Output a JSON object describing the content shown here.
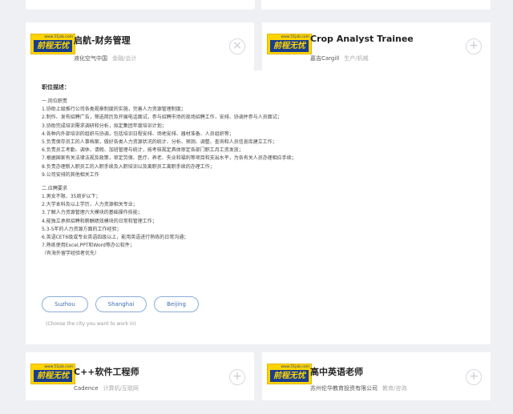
{
  "logo": {
    "url": "www.51job.com",
    "brand": "前程无忧"
  },
  "jobs": [
    {
      "title": "启航-财务管理",
      "company": "液化空气中国",
      "industry": "金融/会计",
      "action": "close"
    },
    {
      "title": "Crop Analyst Trainee",
      "company": "嘉吉Cargill",
      "industry": "生产/机械",
      "action": "add"
    },
    {
      "title": "C++软件工程师",
      "company": "Cadence",
      "industry": "计算机/互联网",
      "action": "add"
    },
    {
      "title": "高中英语老师",
      "company": "苏州伦华教育投资有限公司",
      "industry": "教育/咨询",
      "action": "add"
    }
  ],
  "action_icons": {
    "close": "×",
    "add": "+"
  },
  "description": {
    "heading": "职位描述：",
    "lines": [
      "一.岗位职责",
      "1.协助上级推行公司各类规章制度的实施，完善人力资源管理制度；",
      "2.制作、发布招聘广告，筛选简历及开展电话面试，参与招聘市场的现场招聘工作，安排、协调并参与人员面试；",
      "3.协助完成培训需求调研和分析，拟定集团年度培训计划；",
      "4.各种内外部培训的组织与协调，包括培训日程安排、场地安排、器材准备、人员组织等；",
      "5.负责保存员工的人事档案，做好各类人力资源状况的统计、分析、预测、调整、查询和人员信息库建立工作；",
      "6.负责员工考勤、调休、请假、加班管理与统计，按考核规定具体审定各部门职工月工资发放；",
      "7.根据国家有关法律法规及政策，审定劳保、医疗、养老、失业和福利等项目和支出水平，为各有关人员办理相应手续；",
      "8.负责办理新入职员工的入职手续及入职培训以及离职员工离职手续的办理工作；",
      "9.公司安排的其他相关工作",
      "",
      "二.应聘要求",
      "1.男女不限、35周岁以下；",
      "2.大学本科及以上学历，人力资源相关专业；",
      "3.了解人力资源管理六大模块的基础操作技能；",
      "4.能独立承担招聘和薪酬绩效模块的日常和管理工作；",
      "5.3-5年的人力资源方面的工作经验；",
      "6.英语CET6级或专业英语四级以上，能用英语进行熟练的日常沟通；",
      "7.熟练使用Excel,PPT和Word等办公软件；",
      "（有海外留学经验者优先）"
    ]
  },
  "cities": [
    "Suzhou",
    "Shanghai",
    "Beijing"
  ],
  "city_hint": "(Choose the city you want to work in)"
}
